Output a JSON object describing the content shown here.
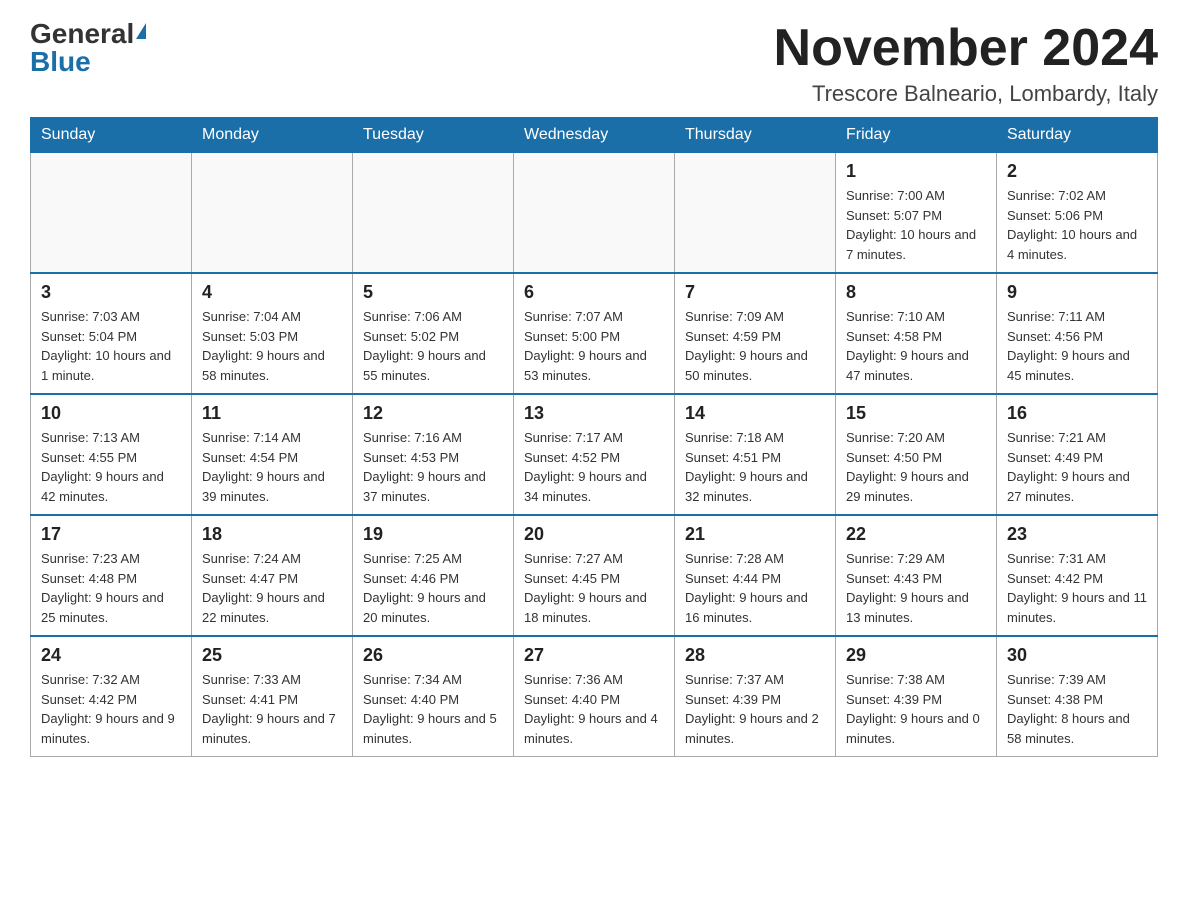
{
  "header": {
    "logo_general": "General",
    "logo_blue": "Blue",
    "month_title": "November 2024",
    "location": "Trescore Balneario, Lombardy, Italy"
  },
  "weekdays": [
    "Sunday",
    "Monday",
    "Tuesday",
    "Wednesday",
    "Thursday",
    "Friday",
    "Saturday"
  ],
  "weeks": [
    [
      {
        "day": "",
        "info": ""
      },
      {
        "day": "",
        "info": ""
      },
      {
        "day": "",
        "info": ""
      },
      {
        "day": "",
        "info": ""
      },
      {
        "day": "",
        "info": ""
      },
      {
        "day": "1",
        "info": "Sunrise: 7:00 AM\nSunset: 5:07 PM\nDaylight: 10 hours and 7 minutes."
      },
      {
        "day": "2",
        "info": "Sunrise: 7:02 AM\nSunset: 5:06 PM\nDaylight: 10 hours and 4 minutes."
      }
    ],
    [
      {
        "day": "3",
        "info": "Sunrise: 7:03 AM\nSunset: 5:04 PM\nDaylight: 10 hours and 1 minute."
      },
      {
        "day": "4",
        "info": "Sunrise: 7:04 AM\nSunset: 5:03 PM\nDaylight: 9 hours and 58 minutes."
      },
      {
        "day": "5",
        "info": "Sunrise: 7:06 AM\nSunset: 5:02 PM\nDaylight: 9 hours and 55 minutes."
      },
      {
        "day": "6",
        "info": "Sunrise: 7:07 AM\nSunset: 5:00 PM\nDaylight: 9 hours and 53 minutes."
      },
      {
        "day": "7",
        "info": "Sunrise: 7:09 AM\nSunset: 4:59 PM\nDaylight: 9 hours and 50 minutes."
      },
      {
        "day": "8",
        "info": "Sunrise: 7:10 AM\nSunset: 4:58 PM\nDaylight: 9 hours and 47 minutes."
      },
      {
        "day": "9",
        "info": "Sunrise: 7:11 AM\nSunset: 4:56 PM\nDaylight: 9 hours and 45 minutes."
      }
    ],
    [
      {
        "day": "10",
        "info": "Sunrise: 7:13 AM\nSunset: 4:55 PM\nDaylight: 9 hours and 42 minutes."
      },
      {
        "day": "11",
        "info": "Sunrise: 7:14 AM\nSunset: 4:54 PM\nDaylight: 9 hours and 39 minutes."
      },
      {
        "day": "12",
        "info": "Sunrise: 7:16 AM\nSunset: 4:53 PM\nDaylight: 9 hours and 37 minutes."
      },
      {
        "day": "13",
        "info": "Sunrise: 7:17 AM\nSunset: 4:52 PM\nDaylight: 9 hours and 34 minutes."
      },
      {
        "day": "14",
        "info": "Sunrise: 7:18 AM\nSunset: 4:51 PM\nDaylight: 9 hours and 32 minutes."
      },
      {
        "day": "15",
        "info": "Sunrise: 7:20 AM\nSunset: 4:50 PM\nDaylight: 9 hours and 29 minutes."
      },
      {
        "day": "16",
        "info": "Sunrise: 7:21 AM\nSunset: 4:49 PM\nDaylight: 9 hours and 27 minutes."
      }
    ],
    [
      {
        "day": "17",
        "info": "Sunrise: 7:23 AM\nSunset: 4:48 PM\nDaylight: 9 hours and 25 minutes."
      },
      {
        "day": "18",
        "info": "Sunrise: 7:24 AM\nSunset: 4:47 PM\nDaylight: 9 hours and 22 minutes."
      },
      {
        "day": "19",
        "info": "Sunrise: 7:25 AM\nSunset: 4:46 PM\nDaylight: 9 hours and 20 minutes."
      },
      {
        "day": "20",
        "info": "Sunrise: 7:27 AM\nSunset: 4:45 PM\nDaylight: 9 hours and 18 minutes."
      },
      {
        "day": "21",
        "info": "Sunrise: 7:28 AM\nSunset: 4:44 PM\nDaylight: 9 hours and 16 minutes."
      },
      {
        "day": "22",
        "info": "Sunrise: 7:29 AM\nSunset: 4:43 PM\nDaylight: 9 hours and 13 minutes."
      },
      {
        "day": "23",
        "info": "Sunrise: 7:31 AM\nSunset: 4:42 PM\nDaylight: 9 hours and 11 minutes."
      }
    ],
    [
      {
        "day": "24",
        "info": "Sunrise: 7:32 AM\nSunset: 4:42 PM\nDaylight: 9 hours and 9 minutes."
      },
      {
        "day": "25",
        "info": "Sunrise: 7:33 AM\nSunset: 4:41 PM\nDaylight: 9 hours and 7 minutes."
      },
      {
        "day": "26",
        "info": "Sunrise: 7:34 AM\nSunset: 4:40 PM\nDaylight: 9 hours and 5 minutes."
      },
      {
        "day": "27",
        "info": "Sunrise: 7:36 AM\nSunset: 4:40 PM\nDaylight: 9 hours and 4 minutes."
      },
      {
        "day": "28",
        "info": "Sunrise: 7:37 AM\nSunset: 4:39 PM\nDaylight: 9 hours and 2 minutes."
      },
      {
        "day": "29",
        "info": "Sunrise: 7:38 AM\nSunset: 4:39 PM\nDaylight: 9 hours and 0 minutes."
      },
      {
        "day": "30",
        "info": "Sunrise: 7:39 AM\nSunset: 4:38 PM\nDaylight: 8 hours and 58 minutes."
      }
    ]
  ]
}
